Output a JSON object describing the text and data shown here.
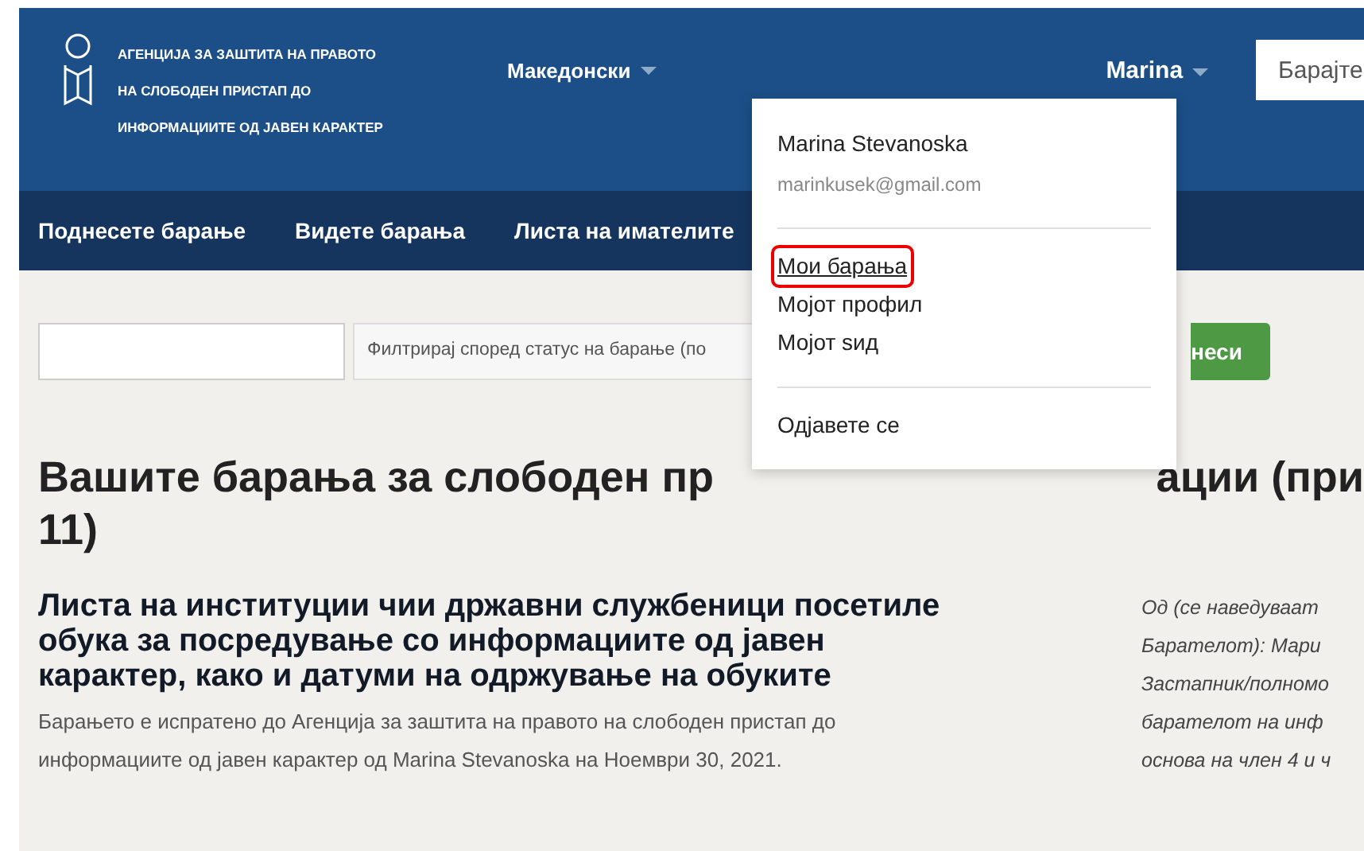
{
  "header": {
    "org_lines": [
      "АГЕНЦИЈА ЗА ЗАШТИТА НА ПРАВОТО",
      "НА СЛОБОДЕН ПРИСТАП ДО",
      "ИНФОРМАЦИИТЕ ОД ЈАВЕН КАРАКТЕР"
    ],
    "language": "Македонски",
    "user": "Marina",
    "search": {
      "placeholder": "Барајте"
    }
  },
  "nav": [
    {
      "label": "Поднесете барање"
    },
    {
      "label": "Видете барања"
    },
    {
      "label": "Листа на имателите"
    }
  ],
  "user_menu": {
    "name": "Marina Stevanoska",
    "email": "marinkusek@gmail.com",
    "groups": [
      [
        {
          "label": "Мои барања",
          "highlighted": true
        },
        {
          "label": "Мојот профил",
          "highlighted": false
        },
        {
          "label": "Мојот ѕид",
          "highlighted": false
        }
      ],
      [
        {
          "label": "Одјавете се",
          "highlighted": false
        }
      ]
    ]
  },
  "filter": {
    "select_text": "Филтрирај според статус на барање (по",
    "button": "неси"
  },
  "heading": {
    "line1_left": "Вашите барања за слободен пр",
    "line1_right": "ации (при",
    "line2": "11)"
  },
  "request": {
    "title": "Листа на институции чии државни службеници посетиле обука за посредување со информациите од јавен карактер, како и датуми на одржување на обуките",
    "meta": "Барањето е испратено до Агенција за заштита на правото на слободен пристап до информациите од јавен карактер од Marina Stevanoska на Ноември 30, 2021.",
    "side_lines": [
      "Од (се наведуваат",
      "Барателот): Мари",
      "Застапник/полномо",
      "барателот на инф",
      "основа на член 4 и ч"
    ]
  }
}
